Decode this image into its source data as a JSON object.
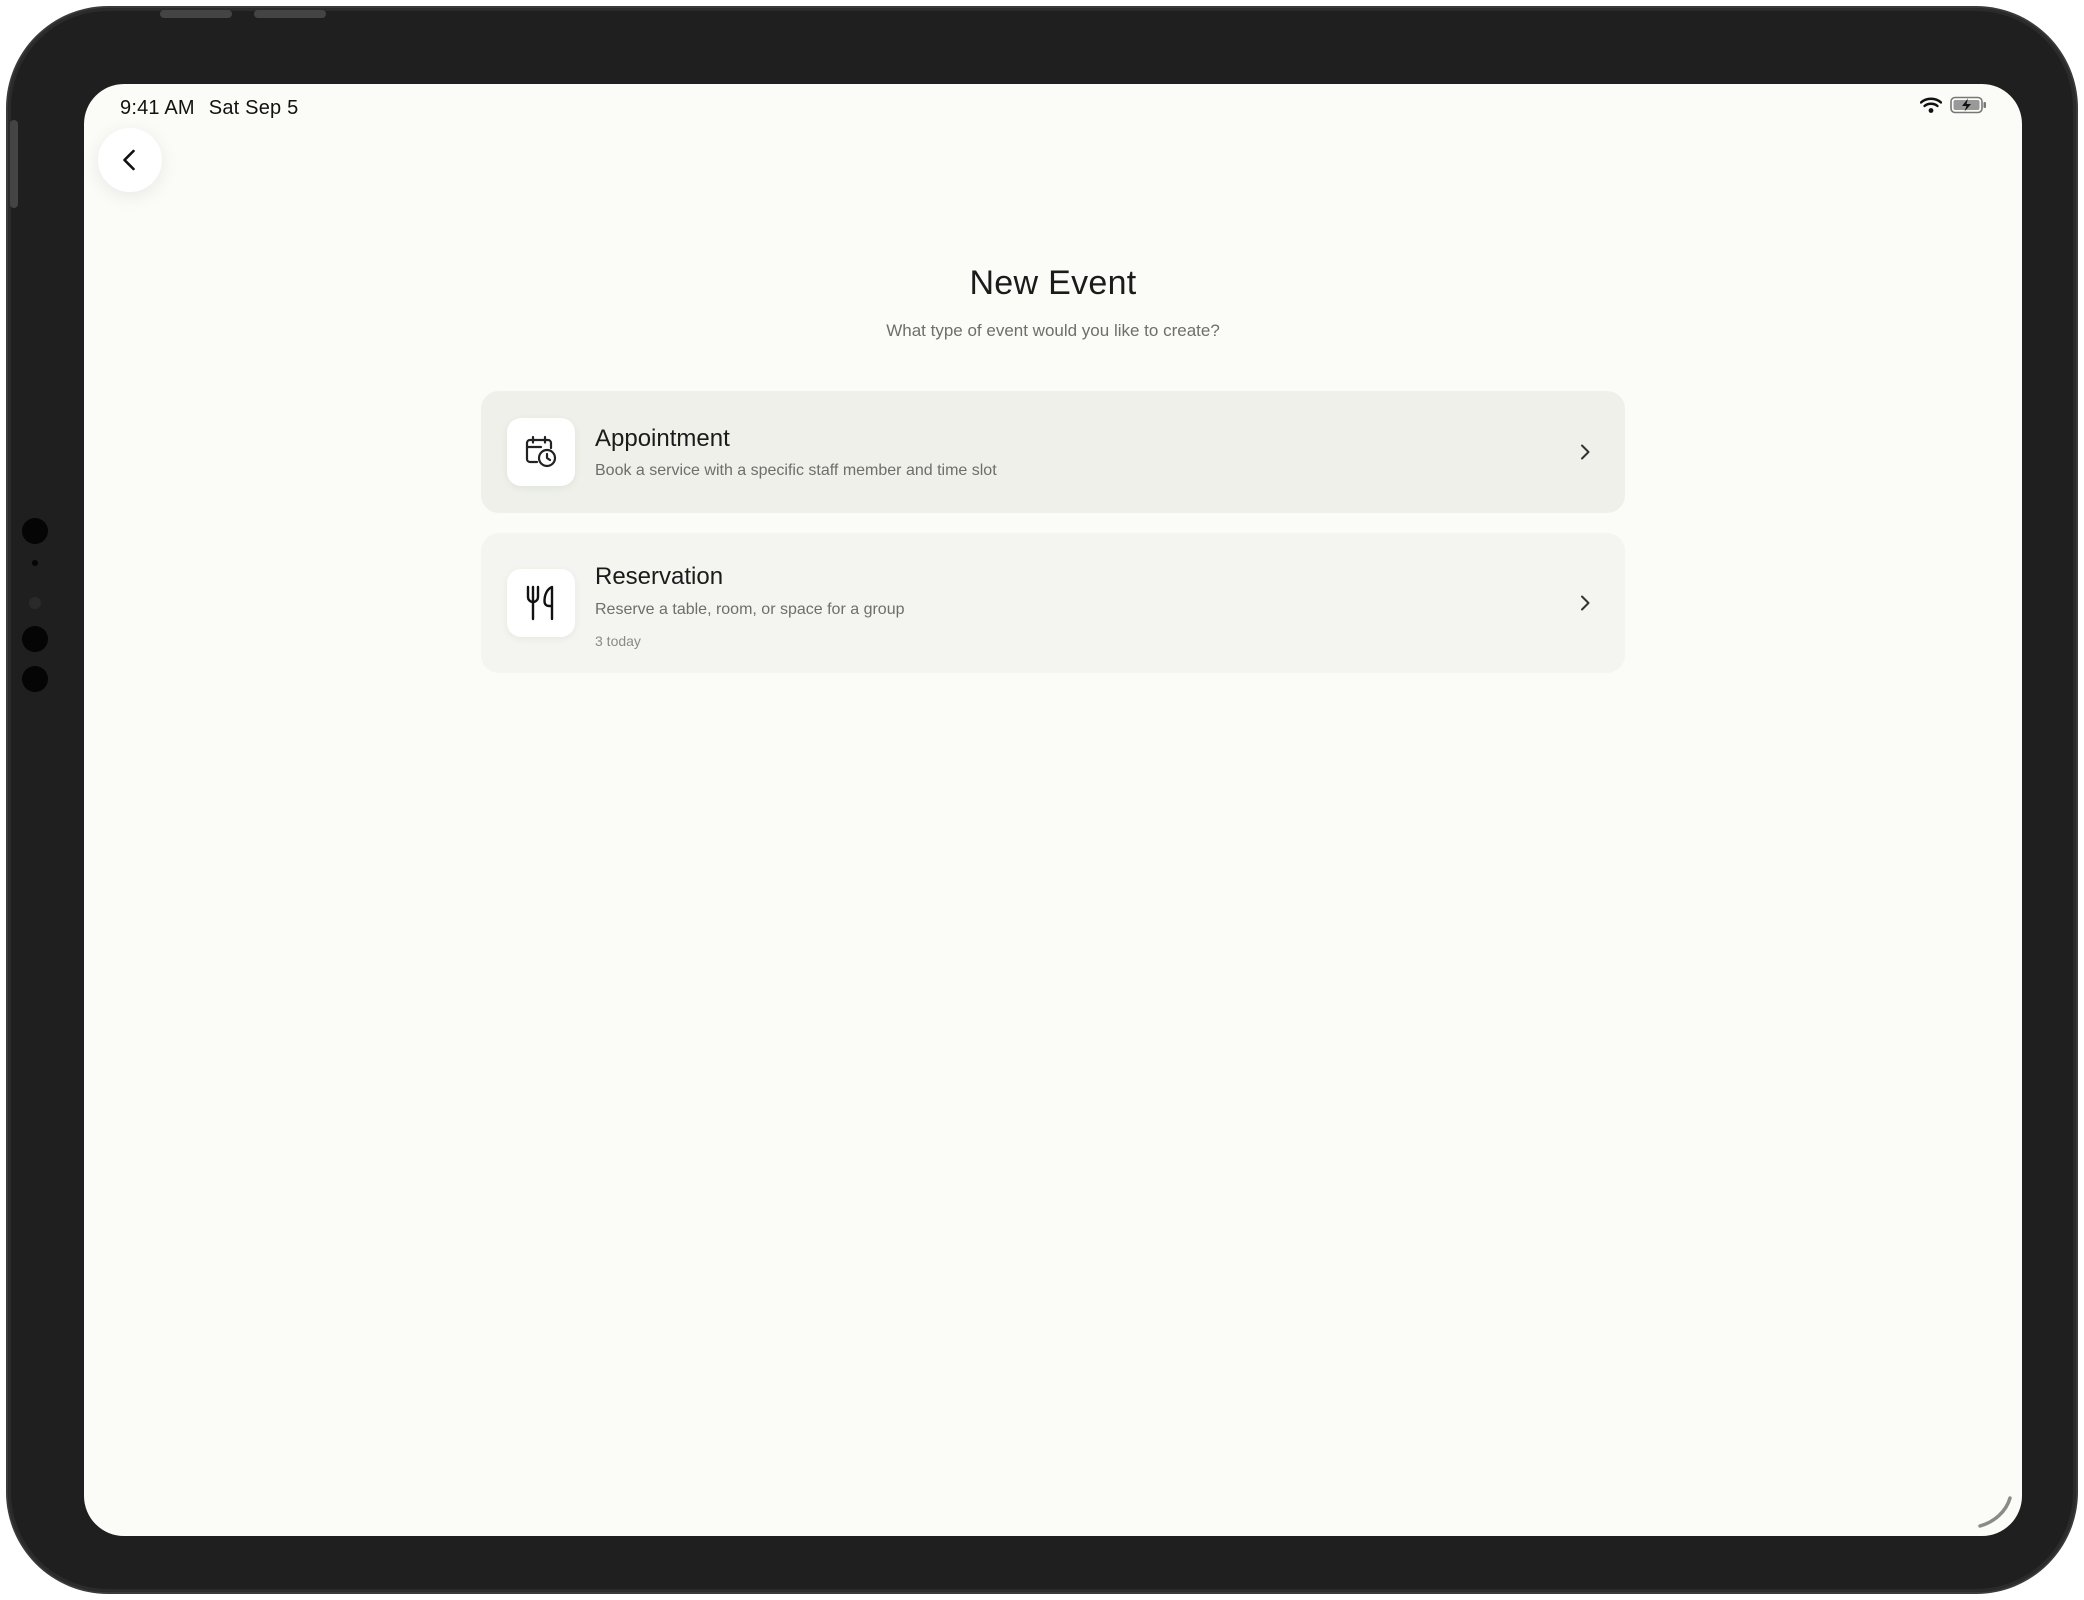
{
  "status_bar": {
    "time": "9:41 AM",
    "date": "Sat Sep 5",
    "icons": [
      "wifi-icon",
      "battery-charging-icon"
    ]
  },
  "navigation": {
    "back_icon": "chevron-left-icon"
  },
  "header": {
    "title": "New Event",
    "subtitle": "What type of event would you like to create?"
  },
  "options": [
    {
      "title": "Appointment",
      "description": "Book a service with a specific staff member and time slot",
      "meta": "",
      "icon": "calendar-clock-icon"
    },
    {
      "title": "Reservation",
      "description": "Reserve a table, room, or space for a group",
      "meta": "3 today",
      "icon": "fork-knife-icon"
    }
  ],
  "colors": {
    "background": "#fbfbf7",
    "card_highlight": "#eef0e9",
    "card": "#f4f5f0",
    "text_primary": "#1b1b1b",
    "text_secondary": "#6e6e6a"
  }
}
